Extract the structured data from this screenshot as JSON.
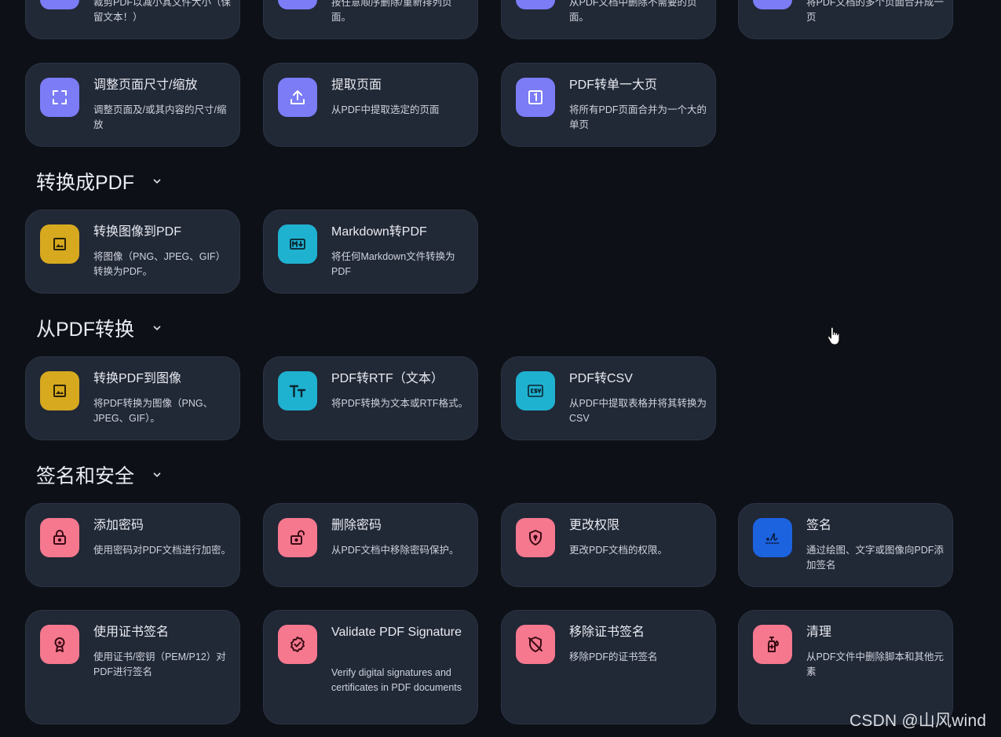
{
  "sections": {
    "convert_to_pdf": {
      "title": "转换成PDF"
    },
    "convert_from_pdf": {
      "title": "从PDF转换"
    },
    "sign_security": {
      "title": "签名和安全"
    }
  },
  "cards": {
    "compress": {
      "title": "",
      "desc": "裁剪PDF以减小其文件大小（保留文本！）"
    },
    "reorder": {
      "title": "",
      "desc": "按任意顺序删除/重新排列页面。"
    },
    "remove_pages": {
      "title": "",
      "desc": "从PDF文档中删除不需要的页面。"
    },
    "merge_pages": {
      "title": "",
      "desc": "将PDF文档的多个页面合并成一页"
    },
    "resize": {
      "title": "调整页面尺寸/缩放",
      "desc": "调整页面及/或其内容的尺寸/缩放"
    },
    "extract": {
      "title": "提取页面",
      "desc": "从PDF中提取选定的页面"
    },
    "single_page": {
      "title": "PDF转单一大页",
      "desc": "将所有PDF页面合并为一个大的单页"
    },
    "img_to_pdf": {
      "title": "转换图像到PDF",
      "desc": "将图像（PNG、JPEG、GIF）转换为PDF。"
    },
    "md_to_pdf": {
      "title": "Markdown转PDF",
      "desc": "将任何Markdown文件转换为PDF"
    },
    "pdf_to_img": {
      "title": "转换PDF到图像",
      "desc": "将PDF转换为图像（PNG、JPEG、GIF）。"
    },
    "pdf_to_rtf": {
      "title": "PDF转RTF（文本）",
      "desc": "将PDF转换为文本或RTF格式。"
    },
    "pdf_to_csv": {
      "title": "PDF转CSV",
      "desc": "从PDF中提取表格并将其转换为CSV"
    },
    "add_password": {
      "title": "添加密码",
      "desc": "使用密码对PDF文档进行加密。"
    },
    "remove_password": {
      "title": "删除密码",
      "desc": "从PDF文档中移除密码保护。"
    },
    "permissions": {
      "title": "更改权限",
      "desc": "更改PDF文档的权限。"
    },
    "sign": {
      "title": "签名",
      "desc": "通过绘图、文字或图像向PDF添加签名"
    },
    "cert_sign": {
      "title": "使用证书签名",
      "desc": "使用证书/密钥（PEM/P12）对PDF进行签名"
    },
    "validate_sig": {
      "title": "Validate PDF Signature",
      "desc": "Verify digital signatures and certificates in PDF documents"
    },
    "remove_cert": {
      "title": "移除证书签名",
      "desc": "移除PDF的证书签名"
    },
    "sanitize": {
      "title": "清理",
      "desc": "从PDF文件中删除脚本和其他元素"
    }
  },
  "icons": {
    "purple": "#7b7cf6",
    "yellow": "#d6a91f",
    "cyan": "#1fb1d0",
    "pink": "#f5788f",
    "blue": "#1c63e0"
  },
  "watermark": "CSDN @山风wind"
}
